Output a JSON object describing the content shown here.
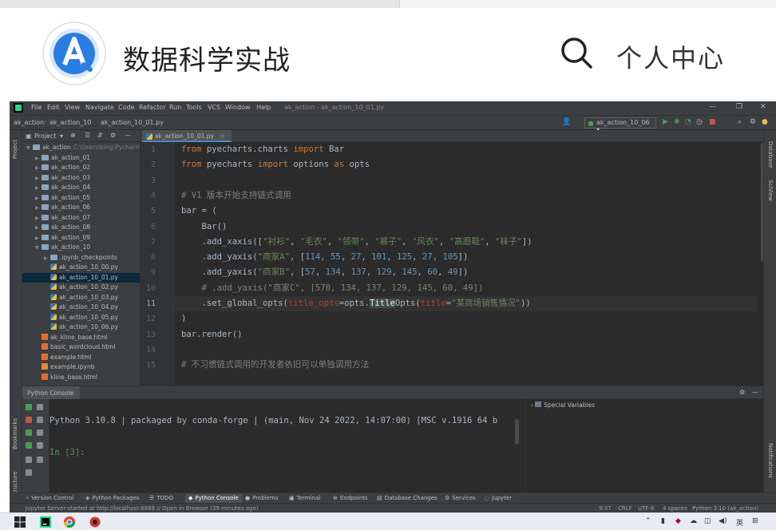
{
  "app": {
    "title": "数据科学实战",
    "user_center": "个人中心",
    "colors": {
      "logo_blue": "#2a7de1",
      "logo_ring": "#d8e6f7"
    }
  },
  "ide": {
    "menu": [
      "File",
      "Edit",
      "View",
      "Navigate",
      "Code",
      "Refactor",
      "Run",
      "Tools",
      "VCS",
      "Window",
      "Help"
    ],
    "window_title": "ak_action - ak_action_10_01.py",
    "breadcrumbs": [
      "ak_action",
      "ak_action_10",
      "ak_action_10_01.py"
    ],
    "run_config": "ak_action_10_06",
    "project_panel_title": "Project",
    "left_stripe": [
      "Project",
      "Bookmarks",
      "Structure"
    ],
    "right_stripe": [
      "Database",
      "SciView",
      "Notifications"
    ],
    "tree": [
      {
        "label": "ak_action",
        "path": "C:\\Users\\king\\Pycharm",
        "kind": "folder",
        "depth": 0,
        "open": true
      },
      {
        "label": "ak_action_01",
        "kind": "folder",
        "depth": 1
      },
      {
        "label": "ak_action_02",
        "kind": "folder",
        "depth": 1
      },
      {
        "label": "ak_action_03",
        "kind": "folder",
        "depth": 1
      },
      {
        "label": "ak_action_04",
        "kind": "folder",
        "depth": 1
      },
      {
        "label": "ak_action_05",
        "kind": "folder",
        "depth": 1
      },
      {
        "label": "ak_action_06",
        "kind": "folder",
        "depth": 1
      },
      {
        "label": "ak_action_07",
        "kind": "folder",
        "depth": 1
      },
      {
        "label": "ak_action_08",
        "kind": "folder",
        "depth": 1
      },
      {
        "label": "ak_action_09",
        "kind": "folder",
        "depth": 1
      },
      {
        "label": "ak_action_10",
        "kind": "folder",
        "depth": 1,
        "open": true
      },
      {
        "label": ".ipynb_checkpoints",
        "kind": "folder",
        "depth": 2
      },
      {
        "label": "ak_action_10_00.py",
        "kind": "py",
        "depth": 2
      },
      {
        "label": "ak_action_10_01.py",
        "kind": "py",
        "depth": 2,
        "selected": true
      },
      {
        "label": "ak_action_10_02.py",
        "kind": "py",
        "depth": 2
      },
      {
        "label": "ak_action_10_03.py",
        "kind": "py",
        "depth": 2
      },
      {
        "label": "ak_action_10_04.py",
        "kind": "py",
        "depth": 2
      },
      {
        "label": "ak_action_10_05.py",
        "kind": "py",
        "depth": 2
      },
      {
        "label": "ak_action_10_06.py",
        "kind": "py",
        "depth": 2
      },
      {
        "label": "ak_kline_base.html",
        "kind": "html",
        "depth": 1
      },
      {
        "label": "basic_wordcloud.html",
        "kind": "html",
        "depth": 1
      },
      {
        "label": "example.html",
        "kind": "html",
        "depth": 1
      },
      {
        "label": "example.ipynb",
        "kind": "nb",
        "depth": 1
      },
      {
        "label": "kline_base.html",
        "kind": "html",
        "depth": 1
      }
    ],
    "editor_tab": "ak_action_10_01.py",
    "warning_badge": "▲1",
    "current_line": 11,
    "code": [
      [
        [
          "kw",
          "from"
        ],
        [
          "tx",
          " pyecharts.charts "
        ],
        [
          "kw",
          "import"
        ],
        [
          "tx",
          " Bar"
        ]
      ],
      [
        [
          "kw",
          "from"
        ],
        [
          "tx",
          " pyecharts "
        ],
        [
          "kw",
          "import"
        ],
        [
          "tx",
          " options "
        ],
        [
          "kw",
          "as"
        ],
        [
          "tx",
          " opts"
        ]
      ],
      [],
      [
        [
          "cm",
          "# V1 版本开始支持链式调用"
        ]
      ],
      [
        [
          "tx",
          "bar = ("
        ]
      ],
      [
        [
          "tx",
          "    Bar()"
        ]
      ],
      [
        [
          "tx",
          "    .add_xaxis(["
        ],
        [
          "st",
          "\"衬衫\""
        ],
        [
          "tx",
          ", "
        ],
        [
          "st",
          "\"毛衣\""
        ],
        [
          "tx",
          ", "
        ],
        [
          "st",
          "\"领带\""
        ],
        [
          "tx",
          ", "
        ],
        [
          "st",
          "\"裤子\""
        ],
        [
          "tx",
          ", "
        ],
        [
          "st",
          "\"风衣\""
        ],
        [
          "tx",
          ", "
        ],
        [
          "st",
          "\"高跟鞋\""
        ],
        [
          "tx",
          ", "
        ],
        [
          "st",
          "\"袜子\""
        ],
        [
          "tx",
          "])"
        ]
      ],
      [
        [
          "tx",
          "    .add_yaxis("
        ],
        [
          "st",
          "\"商家A\""
        ],
        [
          "tx",
          ", ["
        ],
        [
          "nm",
          "114"
        ],
        [
          "tx",
          ", "
        ],
        [
          "nm",
          "55"
        ],
        [
          "tx",
          ", "
        ],
        [
          "nm",
          "27"
        ],
        [
          "tx",
          ", "
        ],
        [
          "nm",
          "101"
        ],
        [
          "tx",
          ", "
        ],
        [
          "nm",
          "125"
        ],
        [
          "tx",
          ", "
        ],
        [
          "nm",
          "27"
        ],
        [
          "tx",
          ", "
        ],
        [
          "nm",
          "105"
        ],
        [
          "tx",
          "])"
        ]
      ],
      [
        [
          "tx",
          "    .add_yaxis("
        ],
        [
          "st",
          "\"商家B\""
        ],
        [
          "tx",
          ", ["
        ],
        [
          "nm",
          "57"
        ],
        [
          "tx",
          ", "
        ],
        [
          "nm",
          "134"
        ],
        [
          "tx",
          ", "
        ],
        [
          "nm",
          "137"
        ],
        [
          "tx",
          ", "
        ],
        [
          "nm",
          "129"
        ],
        [
          "tx",
          ", "
        ],
        [
          "nm",
          "145"
        ],
        [
          "tx",
          ", "
        ],
        [
          "nm",
          "60"
        ],
        [
          "tx",
          ", "
        ],
        [
          "nm",
          "49"
        ],
        [
          "tx",
          "])"
        ]
      ],
      [
        [
          "cm",
          "    # .add_yaxis(\"商家C\", [570, 134, 137, 129, 145, 60, 49])"
        ]
      ],
      [
        [
          "tx",
          "    .set_global_opts("
        ],
        [
          "pr",
          "title_opts"
        ],
        [
          "tx",
          "=opts."
        ],
        [
          "pend",
          "Title"
        ],
        [
          "tx",
          "Opts("
        ],
        [
          "pr",
          "title"
        ],
        [
          "tx",
          "="
        ],
        [
          "st",
          "\"某商场销售情况\""
        ],
        [
          "tx",
          "))"
        ]
      ],
      [
        [
          "tx",
          ")"
        ]
      ],
      [
        [
          "tx",
          "bar.render()"
        ]
      ],
      [],
      [
        [
          "cm",
          "# 不习惯链式调用的开发者依旧可以单独调用方法"
        ]
      ]
    ],
    "console": {
      "tab": "Python Console",
      "banner": "Python 3.10.8 | packaged by conda-forge | (main, Nov 24 2022, 14:07:00) [MSC v.1916 64 b",
      "prompt": "In [3]:",
      "vars_title": "Special Variables"
    },
    "bottom_tabs": [
      "Version Control",
      "Python Packages",
      "TODO",
      "Python Console",
      "Problems",
      "Terminal",
      "Endpoints",
      "Database Changes",
      "Services",
      "Jupyter"
    ],
    "active_bottom_tab": "Python Console",
    "status_left": "Jupyter Server started at http://localhost:8888 // Open in Browser (39 minutes ago)",
    "status_right": [
      "9:37",
      "CRLF",
      "UTF-8",
      "4 spaces",
      "Python 3.10 (ak_action)"
    ]
  },
  "taskbar": {
    "tray_lang": "英"
  }
}
